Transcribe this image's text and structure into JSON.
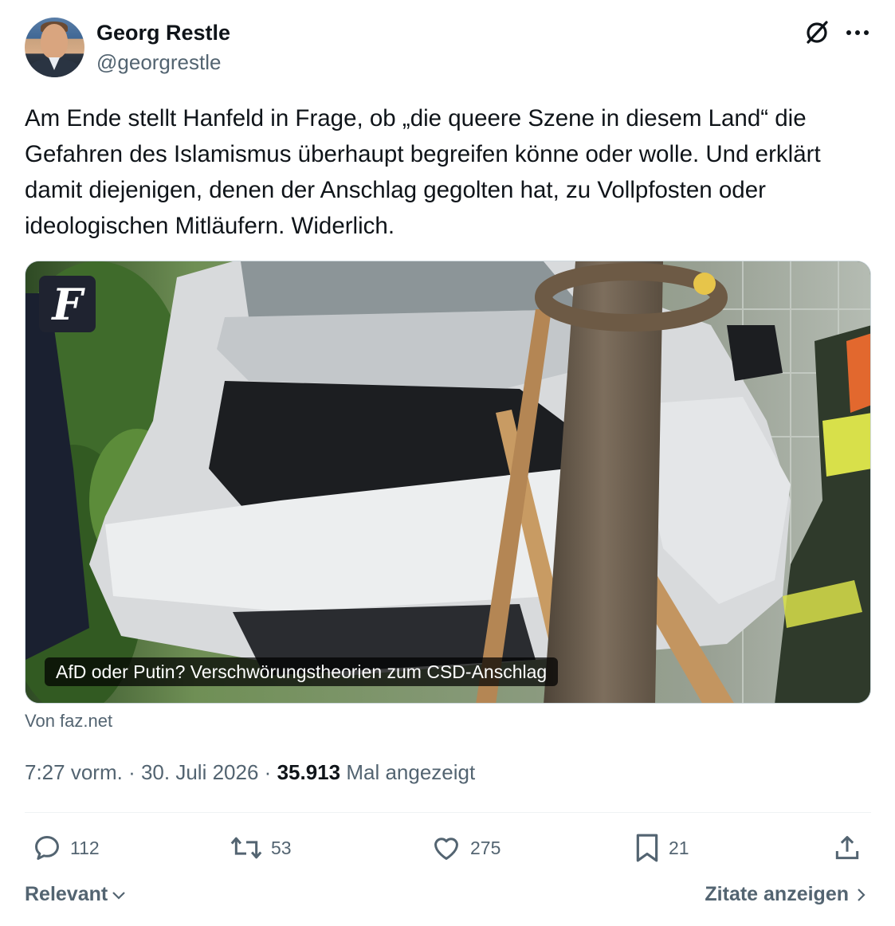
{
  "author": {
    "display_name": "Georg Restle",
    "handle": "@georgrestle"
  },
  "tweet": {
    "text": "Am Ende stellt Hanfeld in Frage, ob „die queere Szene in diesem Land“ die Gefahren des Islamismus überhaupt begreifen könne oder wolle. Und erklärt damit diejenigen, denen der Anschlag gegolten hat, zu Vollpfosten oder ideologischen Mitläufern. Widerlich."
  },
  "card": {
    "logo_letter": "F",
    "caption": "AfD oder Putin? Verschwörungstheorien zum CSD-Anschlag",
    "source": "Von faz.net"
  },
  "meta": {
    "time": "7:27 vorm.",
    "separator": "·",
    "date": "30. Juli 2026",
    "views_count": "35.913",
    "views_label": "Mal angezeigt"
  },
  "actions": {
    "replies": "112",
    "reposts": "53",
    "likes": "275",
    "bookmarks": "21"
  },
  "footer": {
    "sort_label": "Relevant",
    "quotes_label": "Zitate anzeigen"
  },
  "icons": [
    "grok-icon",
    "more-icon",
    "reply-icon",
    "repost-icon",
    "like-icon",
    "bookmark-icon",
    "share-icon",
    "chevron-down-icon",
    "chevron-right-icon"
  ],
  "colors": {
    "text_primary": "#0f1419",
    "text_secondary": "#536471",
    "border": "#cfd9de"
  }
}
